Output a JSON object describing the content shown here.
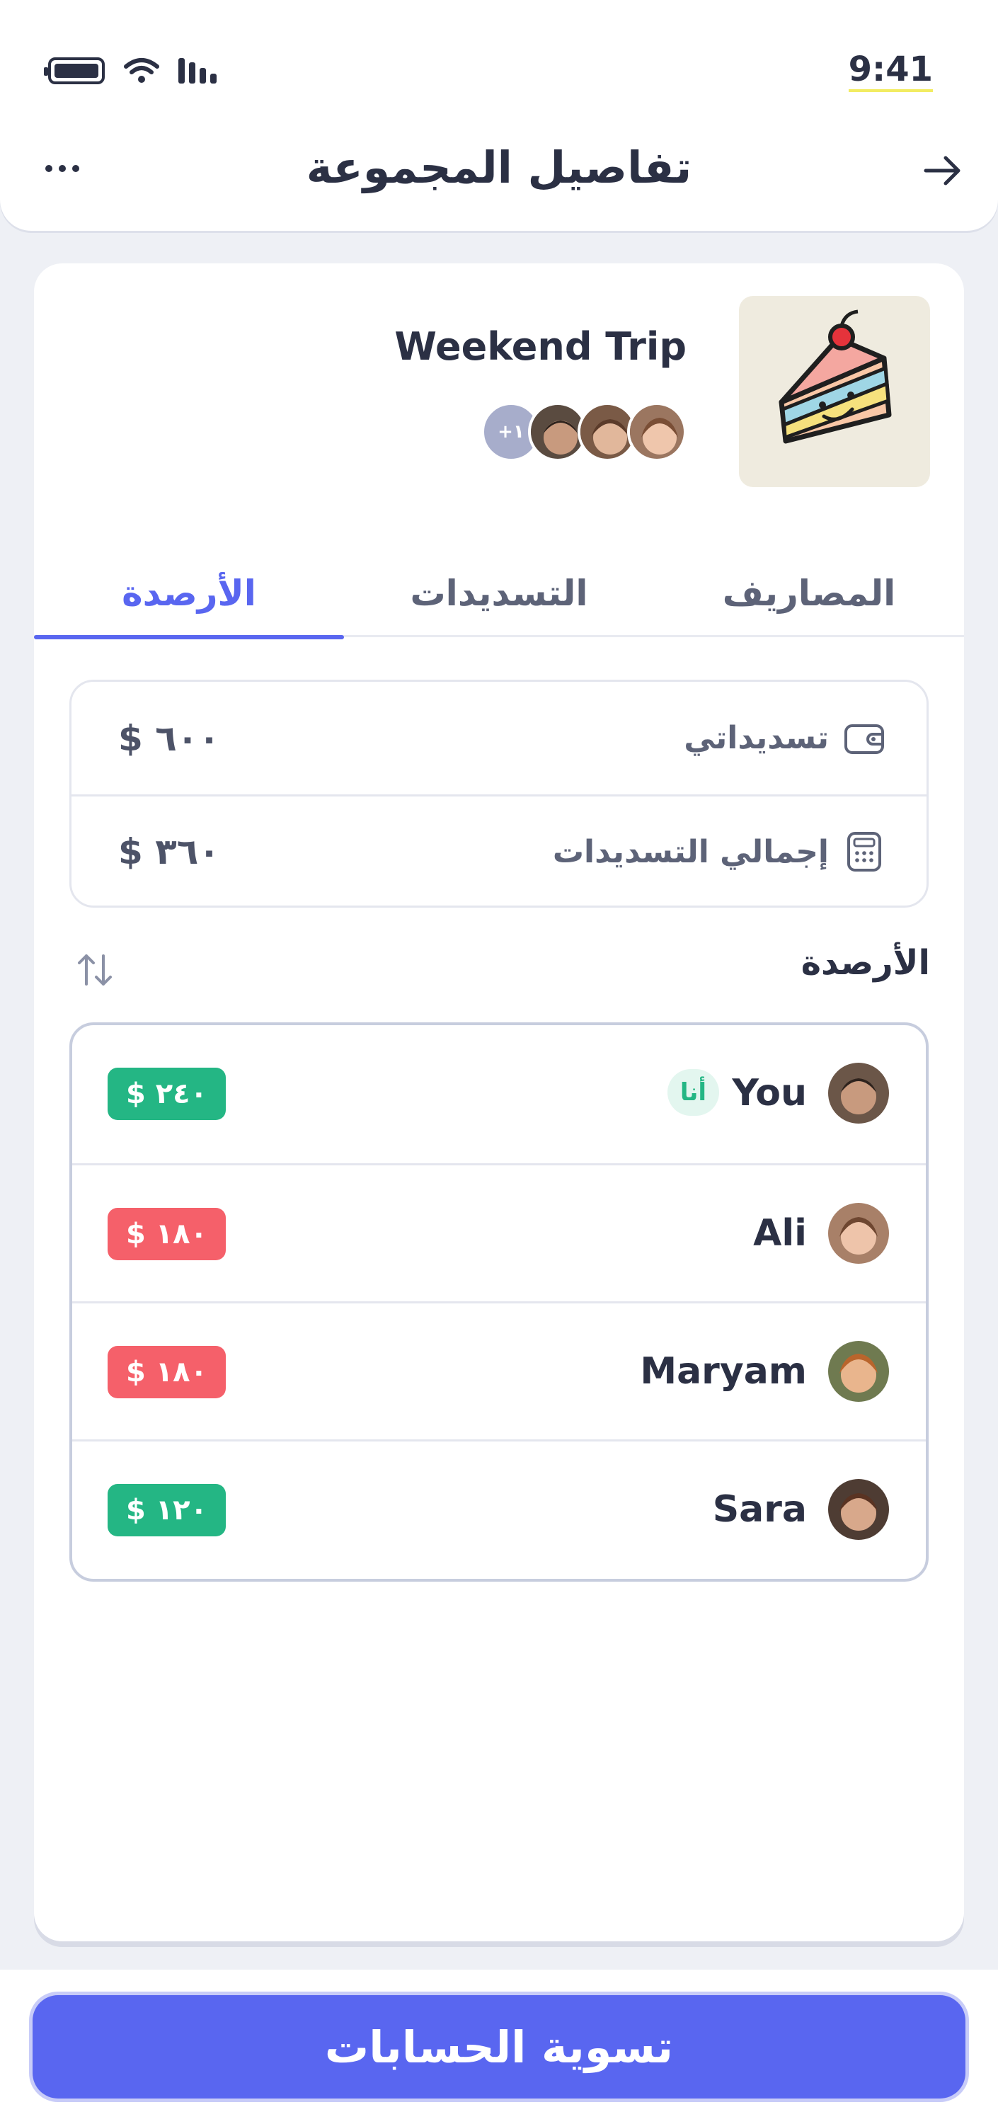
{
  "status_bar": {
    "time": "9:41"
  },
  "header": {
    "title": "تفاصيل المجموعة",
    "more_icon": "more-horizontal-icon",
    "back_icon": "arrow-right-icon"
  },
  "group": {
    "name": "Weekend Trip",
    "thumbnail_icon": "cake-slice-icon",
    "extra_members_label": "+١",
    "member_avatar_colors": [
      "#8a6a55",
      "#b98e73",
      "#c9a08a"
    ]
  },
  "tabs": [
    {
      "label": "المصاريف",
      "active": false
    },
    {
      "label": "التسديدات",
      "active": false
    },
    {
      "label": "الأرصدة",
      "active": true
    }
  ],
  "summary": {
    "my_payments": {
      "label": "تسديداتي",
      "value": "$ ٦٠٠",
      "icon": "wallet-icon"
    },
    "total_payments": {
      "label": "إجمالي التسديدات",
      "value": "$ ٣٦٠",
      "icon": "calculator-icon"
    }
  },
  "balances": {
    "title": "الأرصدة",
    "sort_icon": "sort-arrows-icon",
    "rows": [
      {
        "name": "You",
        "me_badge": "أنا",
        "amount": "$ ٢٤٠",
        "status": "positive",
        "avatar_color": "#7b5b48"
      },
      {
        "name": "Ali",
        "amount": "$ ١٨٠",
        "status": "negative",
        "avatar_color": "#c8a08a"
      },
      {
        "name": "Maryam",
        "amount": "$ ١٨٠",
        "status": "negative",
        "avatar_color": "#b5703e"
      },
      {
        "name": "Sara",
        "amount": "$ ١٢٠",
        "status": "positive",
        "avatar_color": "#8d5f46"
      }
    ]
  },
  "footer": {
    "settle_button": "تسوية الحسابات"
  },
  "colors": {
    "accent": "#5966f0",
    "positive": "#24b684",
    "negative": "#f5606a"
  }
}
